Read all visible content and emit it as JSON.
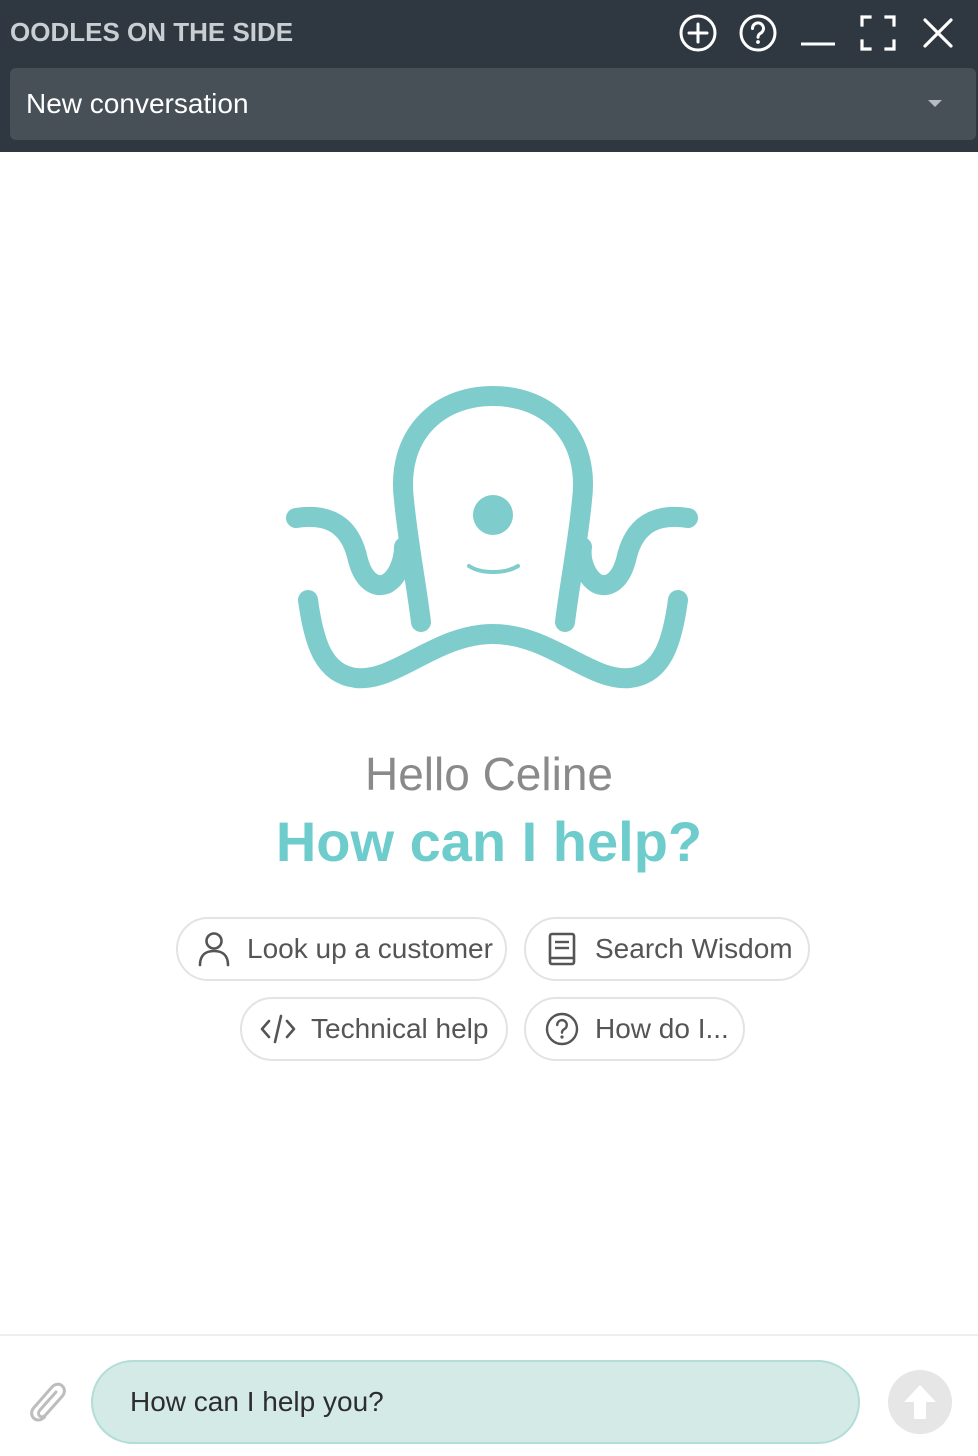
{
  "header": {
    "title": "OODLES ON THE SIDE",
    "actions": [
      {
        "name": "new-conversation-button",
        "icon": "plus-circle-icon"
      },
      {
        "name": "help-button",
        "icon": "question-circle-icon"
      },
      {
        "name": "minimize-button",
        "icon": "minimize-icon"
      },
      {
        "name": "expand-button",
        "icon": "expand-icon"
      },
      {
        "name": "close-button",
        "icon": "close-icon"
      }
    ]
  },
  "conversation_select": {
    "selected": "New conversation",
    "icon": "caret-down-icon"
  },
  "hero": {
    "mascot_icon": "octopus-icon",
    "greeting": "Hello Celine",
    "prompt": "How can I help?"
  },
  "suggestions": [
    {
      "label": "Look up a customer",
      "icon": "person-icon"
    },
    {
      "label": "Search Wisdom",
      "icon": "book-icon"
    },
    {
      "label": "Technical help",
      "icon": "code-icon"
    },
    {
      "label": "How do I...",
      "icon": "question-circle-icon"
    }
  ],
  "composer": {
    "placeholder": "How can I help you?",
    "attach_icon": "paperclip-icon",
    "send_icon": "arrow-up-icon"
  },
  "colors": {
    "header_bg": "#2f3840",
    "select_bg": "#474f57",
    "accent": "#7ecccc",
    "input_bg": "#d3eae7"
  }
}
